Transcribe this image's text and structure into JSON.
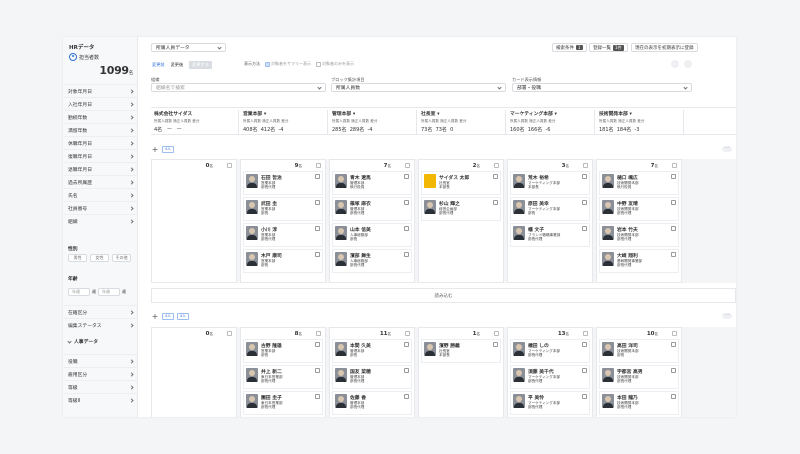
{
  "sidebar": {
    "title": "HRデータ",
    "user_label": "担当者数",
    "count": "1099",
    "count_unit": "名",
    "items": [
      "対象年月日",
      "入社年月日",
      "勤続年数",
      "満留年数",
      "休職年月日",
      "復職年月日",
      "退職年月日",
      "過去所属歴",
      "氏名",
      "社員番号",
      "組織"
    ],
    "gender_label": "性別",
    "gender_options": [
      "男性",
      "女性",
      "その他"
    ],
    "age_label": "年齢",
    "age_from": "年歳",
    "age_to": "年歳",
    "age_unit": "歳",
    "items2": [
      "在籍区分",
      "編集ステータス"
    ],
    "section": "人事データ",
    "items3": [
      "役職",
      "雇用区分",
      "等級",
      "等級Ⅱ"
    ]
  },
  "top": {
    "view_select": "所属人員データ",
    "search_btn": "検索条件",
    "search_count": "1",
    "reg_btn": "登録一覧",
    "reg_count": "1件",
    "save_btn": "現在の表示を初期表示に登録"
  },
  "tabs": [
    "変更前",
    "変更後",
    "変更する"
  ],
  "display": {
    "label": "表示方法",
    "opt1": "対象者をサマリー表示",
    "opt2": "対象者のみを表示"
  },
  "filters": {
    "org_label": "組織",
    "org_placeholder": "組織名で検索",
    "block_label": "ブロック集計項目",
    "block_value": "所属人員数",
    "card_label": "カード表示情報",
    "card_value": "部署・役職"
  },
  "stats_headers": [
    "所属人員数",
    "適正人員数",
    "差分"
  ],
  "stats": [
    {
      "name": "株式会社サイダス",
      "a": "4名",
      "b": "ー",
      "c": "ー"
    },
    {
      "name": "営業本部",
      "a": "408名",
      "b": "412名",
      "c": "-4"
    },
    {
      "name": "管理本部",
      "a": "285名",
      "b": "289名",
      "c": "-4"
    },
    {
      "name": "社長室",
      "a": "73名",
      "b": "73名",
      "c": "0"
    },
    {
      "name": "マーケティング本部",
      "a": "160名",
      "b": "166名",
      "c": "-6"
    },
    {
      "name": "技術開発本部",
      "a": "181名",
      "b": "184名",
      "c": "-3"
    }
  ],
  "row_tag1": "4人",
  "row_tag2": "4人",
  "row_tag3": "4人",
  "load_more": "読み込む",
  "row1": [
    {
      "count": "0",
      "unit": "名",
      "cards": []
    },
    {
      "count": "9",
      "unit": "名",
      "cards": [
        {
          "name": "石田 哲治",
          "l1": "営業本部",
          "l2": "部長代理"
        },
        {
          "name": "武田 圭",
          "l1": "営業本部",
          "l2": "部長"
        },
        {
          "name": "小川 淳",
          "l1": "営業本部",
          "l2": "部長代理"
        },
        {
          "name": "木戸 康司",
          "l1": "営業本部",
          "l2": "部長"
        }
      ]
    },
    {
      "count": "7",
      "unit": "名",
      "cards": [
        {
          "name": "青木 遼馬",
          "l1": "管理本部",
          "l2": "執行役員"
        },
        {
          "name": "篠塚 麻衣",
          "l1": "管理本部",
          "l2": "部長代理"
        },
        {
          "name": "山本 信美",
          "l1": "人事総務部",
          "l2": "部長"
        },
        {
          "name": "濱部 舞生",
          "l1": "人事総務部",
          "l2": "部長代理"
        }
      ]
    },
    {
      "count": "2",
      "unit": "名",
      "cards": [
        {
          "name": "サイダス 太郎",
          "l1": "社長室",
          "l2": "本部長",
          "logo": "cydas"
        },
        {
          "name": "杉山 輝之",
          "l1": "経営企画部",
          "l2": "部長代理"
        }
      ]
    },
    {
      "count": "3",
      "unit": "名",
      "cards": [
        {
          "name": "荒木 裕希",
          "l1": "マーケティング本部",
          "l2": "本部長"
        },
        {
          "name": "原田 美幸",
          "l1": "マーケティング本部",
          "l2": "部長"
        },
        {
          "name": "幡 文子",
          "l1": "ブランド戦略事業部",
          "l2": "部長代理"
        }
      ]
    },
    {
      "count": "7",
      "unit": "名",
      "cards": [
        {
          "name": "樋口 颯広",
          "l1": "技術開発本部",
          "l2": "執行役員"
        },
        {
          "name": "中野 友晴",
          "l1": "技術開発本部",
          "l2": "部長代理"
        },
        {
          "name": "岩本 竹夫",
          "l1": "技術開発本部",
          "l2": "部長代理"
        },
        {
          "name": "大崎 翔利",
          "l1": "基幹開発事業部",
          "l2": "部長代理"
        }
      ]
    }
  ],
  "row2": [
    {
      "count": "0",
      "unit": "名",
      "cards": []
    },
    {
      "count": "8",
      "unit": "名",
      "cards": [
        {
          "name": "古野 隆雄",
          "l1": "営業本部",
          "l2": "部長"
        },
        {
          "name": "井上 新二",
          "l1": "東日本営業部",
          "l2": "部長代理"
        },
        {
          "name": "園田 圭子",
          "l1": "東日本営業部",
          "l2": "部長代理"
        }
      ]
    },
    {
      "count": "11",
      "unit": "名",
      "cards": [
        {
          "name": "本間 久美",
          "l1": "管理本部",
          "l2": "部長"
        },
        {
          "name": "国友 菜穂",
          "l1": "管理本部",
          "l2": "部長代理"
        },
        {
          "name": "佐藤 香",
          "l1": "管理本部",
          "l2": "部長代理"
        }
      ]
    },
    {
      "count": "1",
      "unit": "名",
      "cards": [
        {
          "name": "濱野 勝義",
          "l1": "社長室",
          "l2": "本部長"
        }
      ]
    },
    {
      "count": "13",
      "unit": "名",
      "cards": [
        {
          "name": "橋田 しの",
          "l1": "マーケティング本部",
          "l2": "部長代理"
        },
        {
          "name": "須藤 美千代",
          "l1": "マーケティング本部",
          "l2": "部長代理"
        },
        {
          "name": "平 美怜",
          "l1": "マーケティング本部",
          "l2": "部長代理"
        }
      ]
    },
    {
      "count": "10",
      "unit": "名",
      "cards": [
        {
          "name": "高田 洋司",
          "l1": "技術開発本部",
          "l2": "部長"
        },
        {
          "name": "宇都宮 高男",
          "l1": "技術開発本部",
          "l2": "部長代理"
        },
        {
          "name": "本田 龍乃",
          "l1": "技術開発本部",
          "l2": "部長代理"
        }
      ]
    }
  ]
}
